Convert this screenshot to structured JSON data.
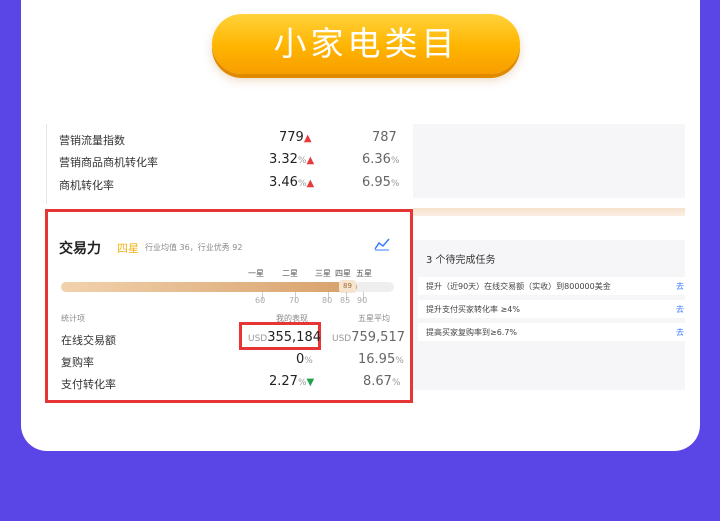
{
  "banner": {
    "title": "小家电类目"
  },
  "top_metrics": [
    {
      "label": "营销流量指数",
      "value": "779",
      "trend": "up",
      "avg": "787",
      "avg_unit": ""
    },
    {
      "label": "营销商品商机转化率",
      "value": "3.32",
      "unit": "%",
      "trend": "up",
      "avg": "6.36",
      "avg_unit": "%"
    },
    {
      "label": "商机转化率",
      "value": "3.46",
      "unit": "%",
      "trend": "up",
      "avg": "6.95",
      "avg_unit": "%"
    }
  ],
  "trade": {
    "title": "交易力",
    "star_level": "四星",
    "industry_note": "行业均值 36，行业优秀 92",
    "star_labels": [
      "一星",
      "二星",
      "三星",
      "四星",
      "五星"
    ],
    "progress": {
      "value": 89,
      "max": 100,
      "marker": "89"
    },
    "ticks": [
      "60",
      "70",
      "80",
      "85",
      "90"
    ],
    "columns": {
      "metric": "统计项",
      "mine": "我的表现",
      "five_star": "五星平均"
    },
    "rows": [
      {
        "label": "在线交易额",
        "prefix": "USD",
        "value": "355,184",
        "trend": "",
        "avg_prefix": "USD",
        "avg": "759,517",
        "avg_unit": ""
      },
      {
        "label": "复购率",
        "prefix": "",
        "value": "0",
        "unit": "%",
        "trend": "",
        "avg_prefix": "",
        "avg": "16.95",
        "avg_unit": "%"
      },
      {
        "label": "支付转化率",
        "prefix": "",
        "value": "2.27",
        "unit": "%",
        "trend": "down",
        "avg_prefix": "",
        "avg": "8.67",
        "avg_unit": "%"
      }
    ]
  },
  "tasks": {
    "title": "3 个待完成任务",
    "items": [
      {
        "text": "提升（近90天）在线交易额（实收）到800000美金",
        "link": "去"
      },
      {
        "text": "提升支付买家转化率 ≥4%",
        "link": "去"
      },
      {
        "text": "提高买家复购率到≥6.7%",
        "link": "去"
      }
    ]
  },
  "icons": {
    "up": "up-arrow-icon",
    "down": "down-arrow-icon",
    "trend": "line-chart-icon"
  },
  "colors": {
    "background": "#5a45e6",
    "banner": "#ffb400",
    "highlight": "#e53535",
    "up": "#e53b3b",
    "down": "#21a04d"
  }
}
